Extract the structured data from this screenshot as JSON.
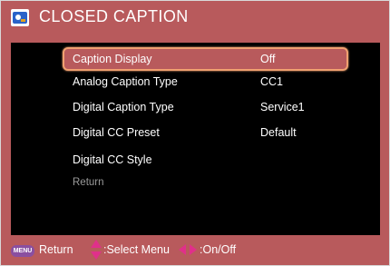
{
  "window": {
    "title": "CLOSED CAPTION",
    "icon": "cc-icon"
  },
  "menu": {
    "items": [
      {
        "label": "Caption Display",
        "value": "Off"
      },
      {
        "label": "Analog Caption Type",
        "value": "CC1"
      },
      {
        "label": "Digital Caption Type",
        "value": "Service1"
      },
      {
        "label": "Digital CC Preset",
        "value": "Default"
      },
      {
        "label": "Digital CC Style",
        "value": ""
      },
      {
        "label": "Return",
        "value": ""
      }
    ]
  },
  "footer": {
    "menu_key": "MENU",
    "return_text": "Return",
    "select_text": ":Select Menu",
    "onoff_text": ":On/Off"
  },
  "colors": {
    "frame": "#b85a5c",
    "panel": "#000000",
    "highlight_border": "#f0a070",
    "arrow": "#e0308a",
    "menu_key": "#8a4fa0"
  }
}
